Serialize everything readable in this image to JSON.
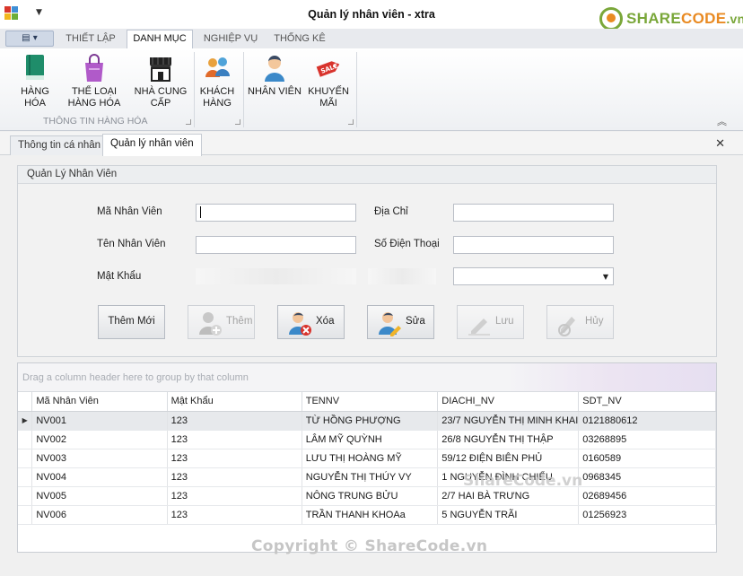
{
  "window": {
    "title": "Quản lý nhân viên - xtra"
  },
  "logo": {
    "text_a": "SHARE",
    "text_b": "CODE",
    "text_c": ".vn"
  },
  "ribbon": {
    "tabs": [
      "THIẾT LẬP",
      "DANH MỤC",
      "NGHIỆP VỤ",
      "THỐNG KÊ"
    ],
    "active_tab": "DANH MỤC",
    "groups": [
      {
        "label": "THÔNG TIN HÀNG HÓA",
        "buttons": [
          {
            "label1": "HÀNG HÓA",
            "label2": "",
            "icon": "book-icon"
          },
          {
            "label1": "THỂ LOẠI",
            "label2": "HÀNG HÓA",
            "icon": "shopping-bag-icon"
          },
          {
            "label1": "NHÀ CUNG",
            "label2": "CẤP",
            "icon": "storefront-icon"
          }
        ]
      },
      {
        "label": "",
        "buttons": [
          {
            "label1": "KHÁCH",
            "label2": "HÀNG",
            "icon": "customers-icon"
          }
        ]
      },
      {
        "label": "",
        "buttons": [
          {
            "label1": "NHÂN VIÊN",
            "label2": "",
            "icon": "employee-icon"
          },
          {
            "label1": "KHUYẾN",
            "label2": "MÃI",
            "icon": "sale-tag-icon"
          }
        ]
      }
    ]
  },
  "doc_tabs": [
    "Thông tin cá nhân",
    "Quản lý nhân viên"
  ],
  "form": {
    "title": "Quản Lý Nhân Viên",
    "labels": {
      "ma_nv": "Mã Nhân Viên",
      "ten_nv": "Tên Nhân Viên",
      "mat_khau": "Mật Khẩu",
      "dia_chi": "Địa Chỉ",
      "sdt": "Số Điện Thoại"
    },
    "values": {
      "ma_nv": "",
      "ten_nv": "",
      "dia_chi": "",
      "sdt": ""
    },
    "buttons": {
      "them_moi": "Thêm Mới",
      "them": "Thêm",
      "xoa": "Xóa",
      "sua": "Sửa",
      "luu": "Lưu",
      "huy": "Hủy"
    }
  },
  "grid": {
    "group_hint": "Drag a column header here to group by that column",
    "columns": [
      "Mã Nhân Viên",
      "Mật Khẩu",
      "TENNV",
      "DIACHI_NV",
      "SDT_NV"
    ],
    "rows": [
      [
        "NV001",
        "123",
        "TỪ HỒNG PHƯỢNG",
        "23/7 NGUYỄN THỊ MINH KHAI",
        "0121880612"
      ],
      [
        "NV002",
        "123",
        "LÂM MỸ QUỲNH",
        "26/8 NGUYỄN THỊ THẬP",
        "03268895"
      ],
      [
        "NV003",
        "123",
        "LƯU THỊ HOÀNG MỸ",
        "59/12 ĐIỆN BIÊN PHỦ",
        "0160589"
      ],
      [
        "NV004",
        "123",
        "NGUYỄN THỊ THÚY VY",
        "1 NGUYỄN ĐÌNH CHIỂU",
        "0968345"
      ],
      [
        "NV005",
        "123",
        "NÔNG TRUNG BỬU",
        "2/7 HAI BÀ TRƯNG",
        "02689456"
      ],
      [
        "NV006",
        "123",
        "TRẦN THANH KHOAa",
        "5 NGUYỄN TRÃI",
        "01256923"
      ]
    ]
  },
  "watermarks": {
    "center": "ShareCode.vn",
    "footer": "Copyright © ShareCode.vn"
  },
  "colors": {
    "brand_green": "#7aa73a",
    "brand_orange": "#e98a22",
    "row_selected": "#e7e9ec"
  }
}
